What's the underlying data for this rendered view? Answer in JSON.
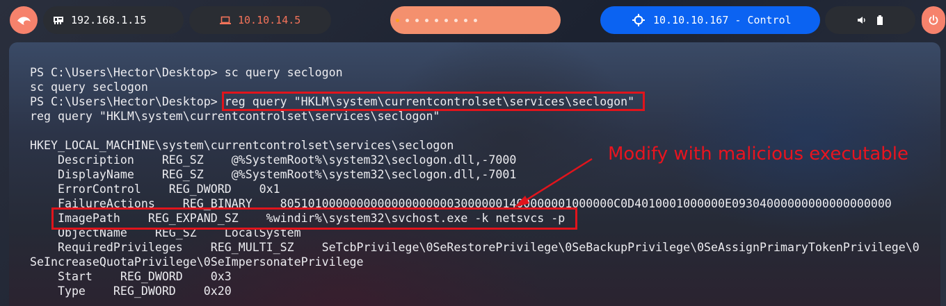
{
  "topbar": {
    "kali_icon": "kali-dragon-icon",
    "local_ip": "192.168.1.15",
    "local_icon": "network-card-icon",
    "vpn_ip": "10.10.14.5",
    "vpn_icon": "laptop-icon",
    "workspaces": {
      "count": 9,
      "active_index": 0
    },
    "target": "10.10.10.167 - Control",
    "target_icon": "crosshair-icon",
    "system_icons": [
      "volume-icon",
      "battery-icon"
    ],
    "power_icon": "power-icon"
  },
  "colors": {
    "accent": "#f6826c",
    "target_blue": "#0b63f2",
    "vpn_text": "#f4735a",
    "highlight_red": "#e1141c"
  },
  "terminal": {
    "lines": [
      "PS C:\\Users\\Hector\\Desktop> sc query seclogon",
      "sc query seclogon",
      "PS C:\\Users\\Hector\\Desktop> reg query \"HKLM\\system\\currentcontrolset\\services\\seclogon\"",
      "reg query \"HKLM\\system\\currentcontrolset\\services\\seclogon\"",
      "",
      "HKEY_LOCAL_MACHINE\\system\\currentcontrolset\\services\\seclogon",
      "    Description    REG_SZ    @%SystemRoot%\\system32\\seclogon.dll,-7000",
      "    DisplayName    REG_SZ    @%SystemRoot%\\system32\\seclogon.dll,-7001",
      "    ErrorControl    REG_DWORD    0x1",
      "    FailureActions    REG_BINARY    805101000000000000000000030000001400000001000000C0D4010001000000E09304000000000000000000",
      "    ImagePath    REG_EXPAND_SZ    %windir%\\system32\\svchost.exe -k netsvcs -p",
      "    ObjectName    REG_SZ    LocalSystem",
      "    RequiredPrivileges    REG_MULTI_SZ    SeTcbPrivilege\\0SeRestorePrivilege\\0SeBackupPrivilege\\0SeAssignPrimaryTokenPrivilege\\0",
      "SeIncreaseQuotaPrivilege\\0SeImpersonatePrivilege",
      "    Start    REG_DWORD    0x3",
      "    Type    REG_DWORD    0x20"
    ]
  },
  "annotation": {
    "text": "Modify with malicious executable"
  }
}
